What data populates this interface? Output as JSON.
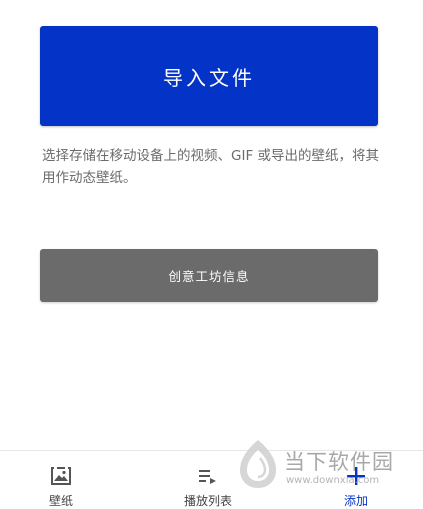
{
  "main": {
    "import_label": "导入文件",
    "description": "选择存储在移动设备上的视频、GIF 或导出的壁纸，将其用作动态壁纸。",
    "workshop_label": "创意工坊信息"
  },
  "bottom_nav": {
    "items": [
      {
        "label": "壁纸",
        "icon": "wallpaper-icon",
        "active": false
      },
      {
        "label": "播放列表",
        "icon": "playlist-icon",
        "active": false
      },
      {
        "label": "添加",
        "icon": "plus-icon",
        "active": true
      }
    ]
  },
  "watermark": {
    "title": "当下软件园",
    "url": "www.downxia.com"
  },
  "colors": {
    "accent": "#0433c7",
    "secondary_button": "#6b6b6b",
    "description_text": "#6b6b6b"
  }
}
